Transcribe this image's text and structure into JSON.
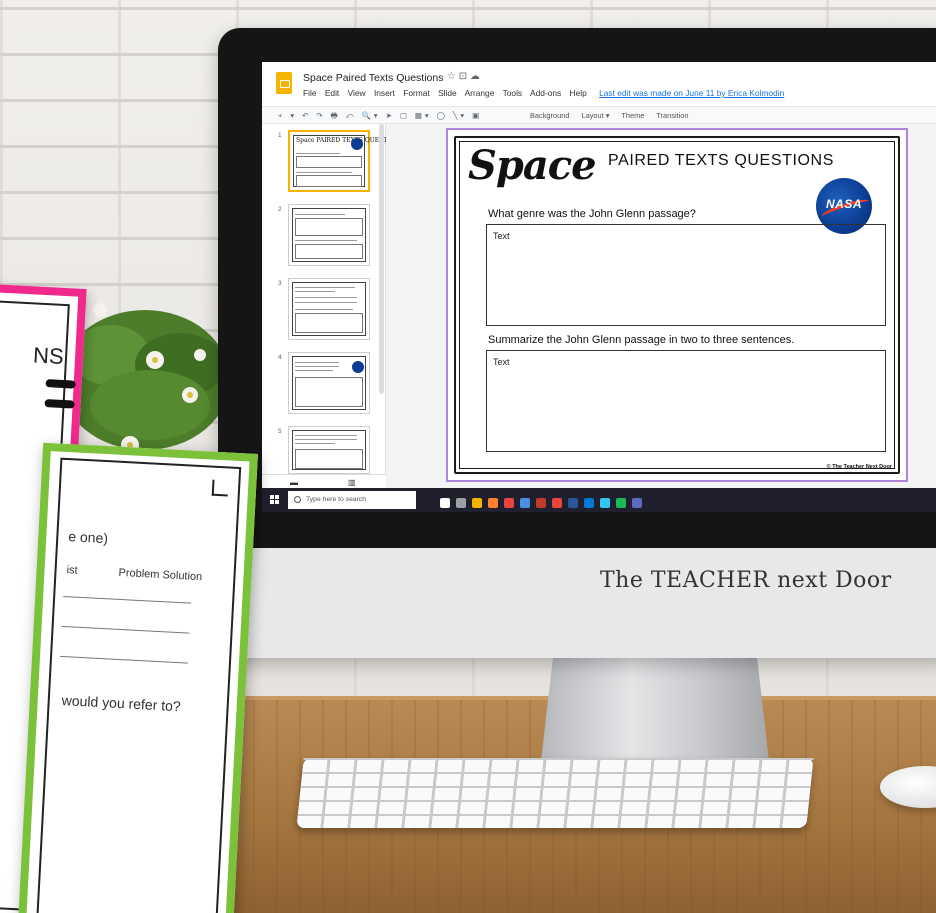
{
  "app": {
    "title": "Space Paired Texts Questions",
    "title_icons": "☆ ⊡ ☁",
    "menu": [
      "File",
      "Edit",
      "View",
      "Insert",
      "Format",
      "Slide",
      "Arrange",
      "Tools",
      "Add-ons",
      "Help"
    ],
    "last_edit": "Last edit was made on June 11 by Erica Kolmodin"
  },
  "toolbar": {
    "icons": "+ ▾ ↶ ↷ 🖶 ⤺ 🔍▾ ➤ ▢ ▦▾ ◯ ╲▾ ▣",
    "buttons": [
      "Background",
      "Layout ▾",
      "Theme",
      "Transition"
    ]
  },
  "filmstrip": {
    "slides": [
      {
        "num": "1",
        "heading": "Space PAIRED TEXTS QUESTIONS",
        "selected": true
      },
      {
        "num": "2",
        "heading": "",
        "selected": false
      },
      {
        "num": "3",
        "heading": "",
        "selected": false
      },
      {
        "num": "4",
        "heading": "",
        "selected": false
      },
      {
        "num": "5",
        "heading": "",
        "selected": false
      }
    ],
    "view_grid": "▬",
    "view_list": "▥"
  },
  "slide": {
    "space_word": "Space",
    "heading": "PAIRED TEXTS QUESTIONS",
    "logo_text": "NASA",
    "question1": "What genre was the John Glenn passage?",
    "answer1": "Text",
    "question2": "Summarize the John Glenn passage in two to three sentences.",
    "answer2": "Text",
    "credit": "© The Teacher Next Door"
  },
  "taskbar": {
    "search_placeholder": "Type here to search",
    "app_colors": [
      "#ffffff",
      "#9aa0a6",
      "#f4b400",
      "#ff7f2a",
      "#e8453c",
      "#4a90e2",
      "#c0392b",
      "#e8453c",
      "#2b579a",
      "#0078d7",
      "#36c5f0",
      "#1db954",
      "#5c6bc0"
    ]
  },
  "monitor": {
    "brand": "The TEACHER next Door"
  },
  "worksheets": {
    "pink_fragment": "NS",
    "green_fragment_one": "e one)",
    "green_fragment_ist": "ist",
    "green_fragment_ps": "Problem Solution",
    "green_fragment_refer": "would you refer to?"
  }
}
